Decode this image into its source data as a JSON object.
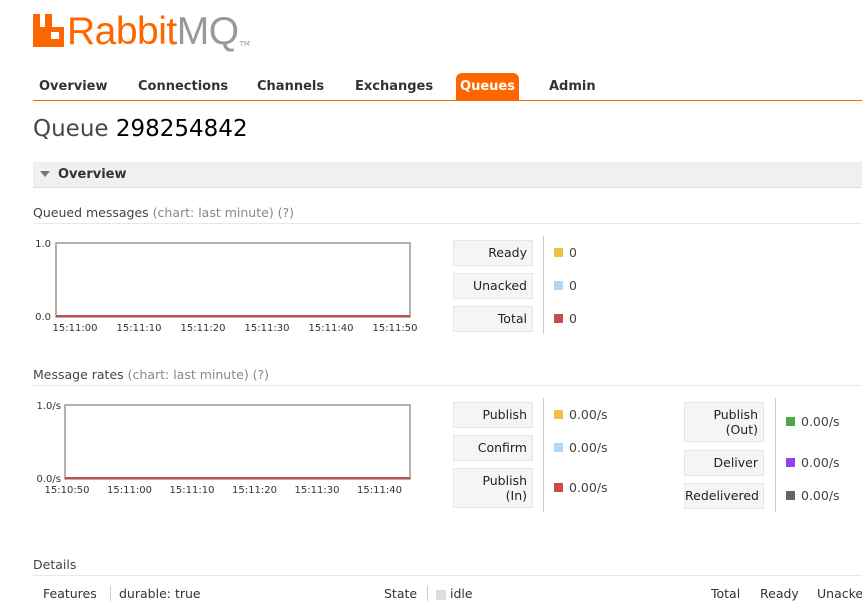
{
  "app": {
    "logo_rabbit": "Rabbit",
    "logo_mq": "MQ",
    "logo_tm": "TM",
    "brand_color": "#ff6600"
  },
  "nav": {
    "tabs": [
      {
        "label": "Overview",
        "active": false
      },
      {
        "label": "Connections",
        "active": false
      },
      {
        "label": "Channels",
        "active": false
      },
      {
        "label": "Exchanges",
        "active": false
      },
      {
        "label": "Queues",
        "active": true
      },
      {
        "label": "Admin",
        "active": false
      }
    ]
  },
  "page": {
    "title_prefix": "Queue",
    "title_name": "298254842"
  },
  "overview_section": {
    "label": "Overview",
    "icon": "triangle-down-icon"
  },
  "queued_messages": {
    "label": "Queued messages",
    "aux": "(chart: last minute) (?)",
    "legend": [
      {
        "label": "Ready",
        "value": "0",
        "color": "#edc240"
      },
      {
        "label": "Unacked",
        "value": "0",
        "color": "#afd8f8"
      },
      {
        "label": "Total",
        "value": "0",
        "color": "#cb4b4b"
      }
    ]
  },
  "message_rates": {
    "label": "Message rates",
    "aux": "(chart: last minute) (?)",
    "legend_left": [
      {
        "label": "Publish",
        "value": "0.00/s",
        "color": "#edc240"
      },
      {
        "label": "Confirm",
        "value": "0.00/s",
        "color": "#afd8f8"
      },
      {
        "label": "Publish (In)",
        "value": "0.00/s",
        "color": "#cb4b4b"
      }
    ],
    "legend_right": [
      {
        "label": "Publish (Out)",
        "value": "0.00/s",
        "color": "#4da74d"
      },
      {
        "label": "Deliver",
        "value": "0.00/s",
        "color": "#9440ed"
      },
      {
        "label": "Redelivered",
        "value": "0.00/s",
        "color": "#666666"
      }
    ]
  },
  "chart_data": [
    {
      "type": "line",
      "title": "Queued messages",
      "x": [
        "15:11:00",
        "15:11:10",
        "15:11:20",
        "15:11:30",
        "15:11:40",
        "15:11:50"
      ],
      "ylim": [
        0.0,
        1.0
      ],
      "ytick_labels": [
        "1.0",
        "0.0"
      ],
      "series": [
        {
          "name": "Ready",
          "values": [
            0,
            0,
            0,
            0,
            0,
            0
          ],
          "color": "#edc240"
        },
        {
          "name": "Unacked",
          "values": [
            0,
            0,
            0,
            0,
            0,
            0
          ],
          "color": "#afd8f8"
        },
        {
          "name": "Total",
          "values": [
            0,
            0,
            0,
            0,
            0,
            0
          ],
          "color": "#cb4b4b"
        }
      ],
      "grid": false
    },
    {
      "type": "line",
      "title": "Message rates",
      "x": [
        "15:10:50",
        "15:11:00",
        "15:11:10",
        "15:11:20",
        "15:11:30",
        "15:11:40"
      ],
      "ylim": [
        0.0,
        1.0
      ],
      "ytick_labels": [
        "1.0/s",
        "0.0/s"
      ],
      "series": [
        {
          "name": "Publish",
          "values": [
            0,
            0,
            0,
            0,
            0,
            0
          ],
          "color": "#edc240"
        },
        {
          "name": "Confirm",
          "values": [
            0,
            0,
            0,
            0,
            0,
            0
          ],
          "color": "#afd8f8"
        },
        {
          "name": "Publish (In)",
          "values": [
            0,
            0,
            0,
            0,
            0,
            0
          ],
          "color": "#cb4b4b"
        }
      ],
      "grid": false
    }
  ],
  "details": {
    "label": "Details",
    "features_label": "Features",
    "features_value": "durable: true",
    "state_label": "State",
    "state_value": "idle",
    "columns": [
      "Total",
      "Ready",
      "Unacked"
    ]
  }
}
